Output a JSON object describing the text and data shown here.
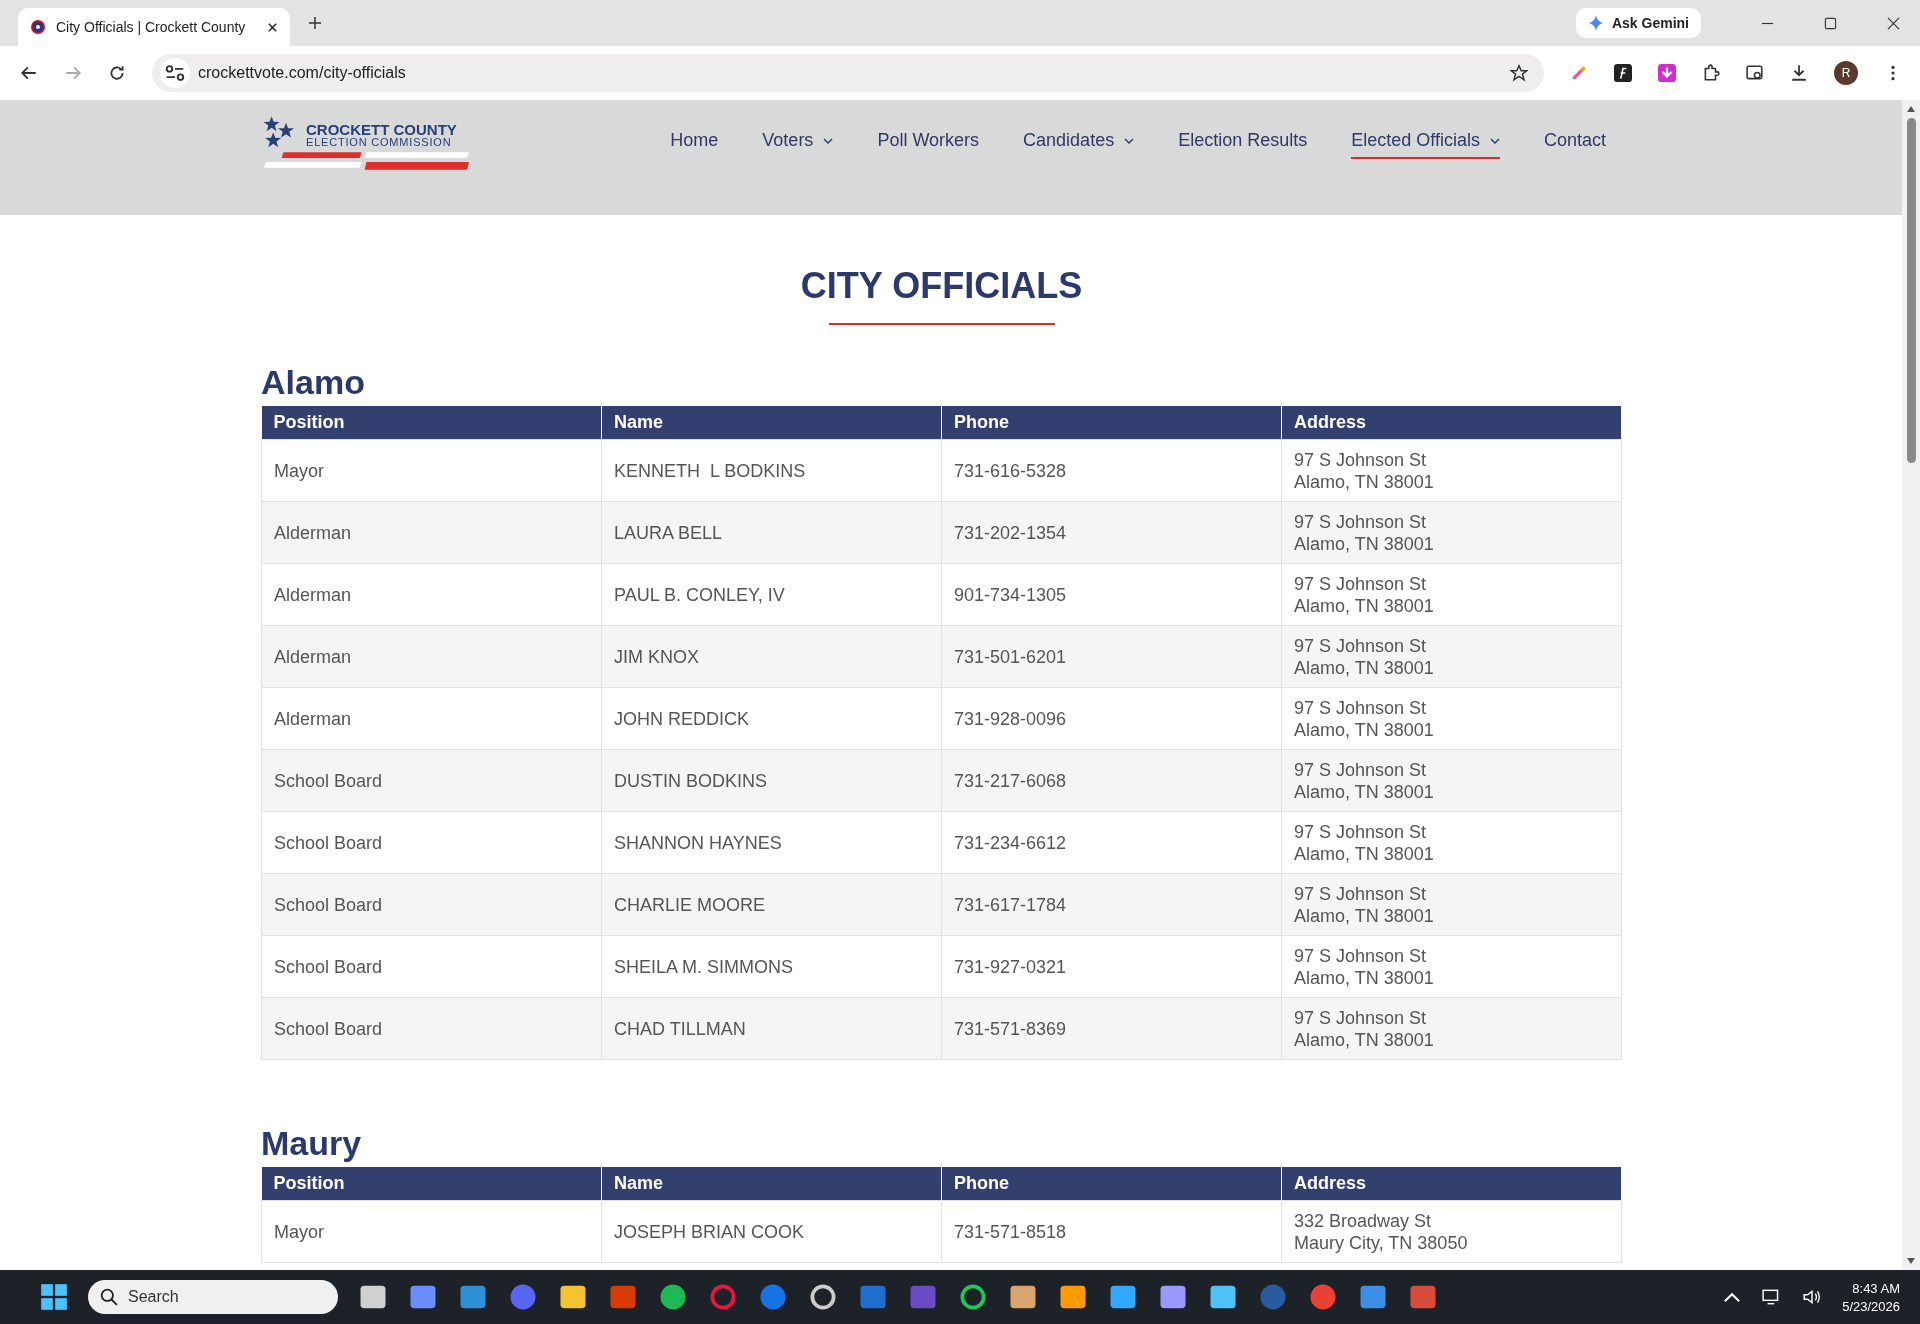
{
  "browser": {
    "tab": {
      "title": "City Officials | Crockett County"
    },
    "url": "crockettvote.com/city-officials",
    "gemini": "Ask Gemini",
    "profile": "R"
  },
  "site": {
    "logo": {
      "line1": "CROCKETT COUNTY",
      "line2": "ELECTION COMMISSION"
    },
    "nav": [
      {
        "label": "Home",
        "dropdown": false,
        "selected": false
      },
      {
        "label": "Voters",
        "dropdown": true,
        "selected": false
      },
      {
        "label": "Poll Workers",
        "dropdown": false,
        "selected": false
      },
      {
        "label": "Candidates",
        "dropdown": true,
        "selected": false
      },
      {
        "label": "Election Results",
        "dropdown": false,
        "selected": false
      },
      {
        "label": "Elected Officials",
        "dropdown": true,
        "selected": true
      },
      {
        "label": "Contact",
        "dropdown": false,
        "selected": false
      }
    ]
  },
  "page_title": "CITY OFFICIALS",
  "sections": [
    {
      "city": "Alamo",
      "columns": [
        "Position",
        "Name",
        "Phone",
        "Address"
      ],
      "rows": [
        [
          "Mayor",
          "KENNETH  L BODKINS",
          "731-616-5328",
          "97 S Johnson St",
          "Alamo, TN 38001"
        ],
        [
          "Alderman",
          "LAURA BELL",
          "731-202-1354",
          "97 S Johnson St",
          "Alamo, TN 38001"
        ],
        [
          "Alderman",
          "PAUL B. CONLEY, IV",
          "901-734-1305",
          "97 S Johnson St",
          "Alamo, TN 38001"
        ],
        [
          "Alderman",
          "JIM KNOX",
          "731-501-6201",
          "97 S Johnson St",
          "Alamo, TN 38001"
        ],
        [
          "Alderman",
          "JOHN REDDICK",
          "731-928-0096",
          "97 S Johnson St",
          "Alamo, TN 38001"
        ],
        [
          "School Board",
          "DUSTIN BODKINS",
          "731-217-6068",
          "97 S Johnson St",
          "Alamo, TN 38001"
        ],
        [
          "School Board",
          "SHANNON HAYNES",
          "731-234-6612",
          "97 S Johnson St",
          "Alamo, TN 38001"
        ],
        [
          "School Board",
          "CHARLIE MOORE",
          "731-617-1784",
          "97 S Johnson St",
          "Alamo, TN 38001"
        ],
        [
          "School Board",
          "SHEILA M. SIMMONS",
          "731-927-0321",
          "97 S Johnson St",
          "Alamo, TN 38001"
        ],
        [
          "School Board",
          "CHAD TILLMAN",
          "731-571-8369",
          "97 S Johnson St",
          "Alamo, TN 38001"
        ]
      ]
    },
    {
      "city": "Maury",
      "columns": [
        "Position",
        "Name",
        "Phone",
        "Address"
      ],
      "rows": [
        [
          "Mayor",
          "JOSEPH BRIAN COOK",
          "731-571-8518",
          "332 Broadway St",
          "Maury City, TN 38050"
        ]
      ]
    }
  ],
  "taskbar": {
    "search_placeholder": "Search",
    "time": "8:43 AM",
    "date": "5/23/2026"
  }
}
